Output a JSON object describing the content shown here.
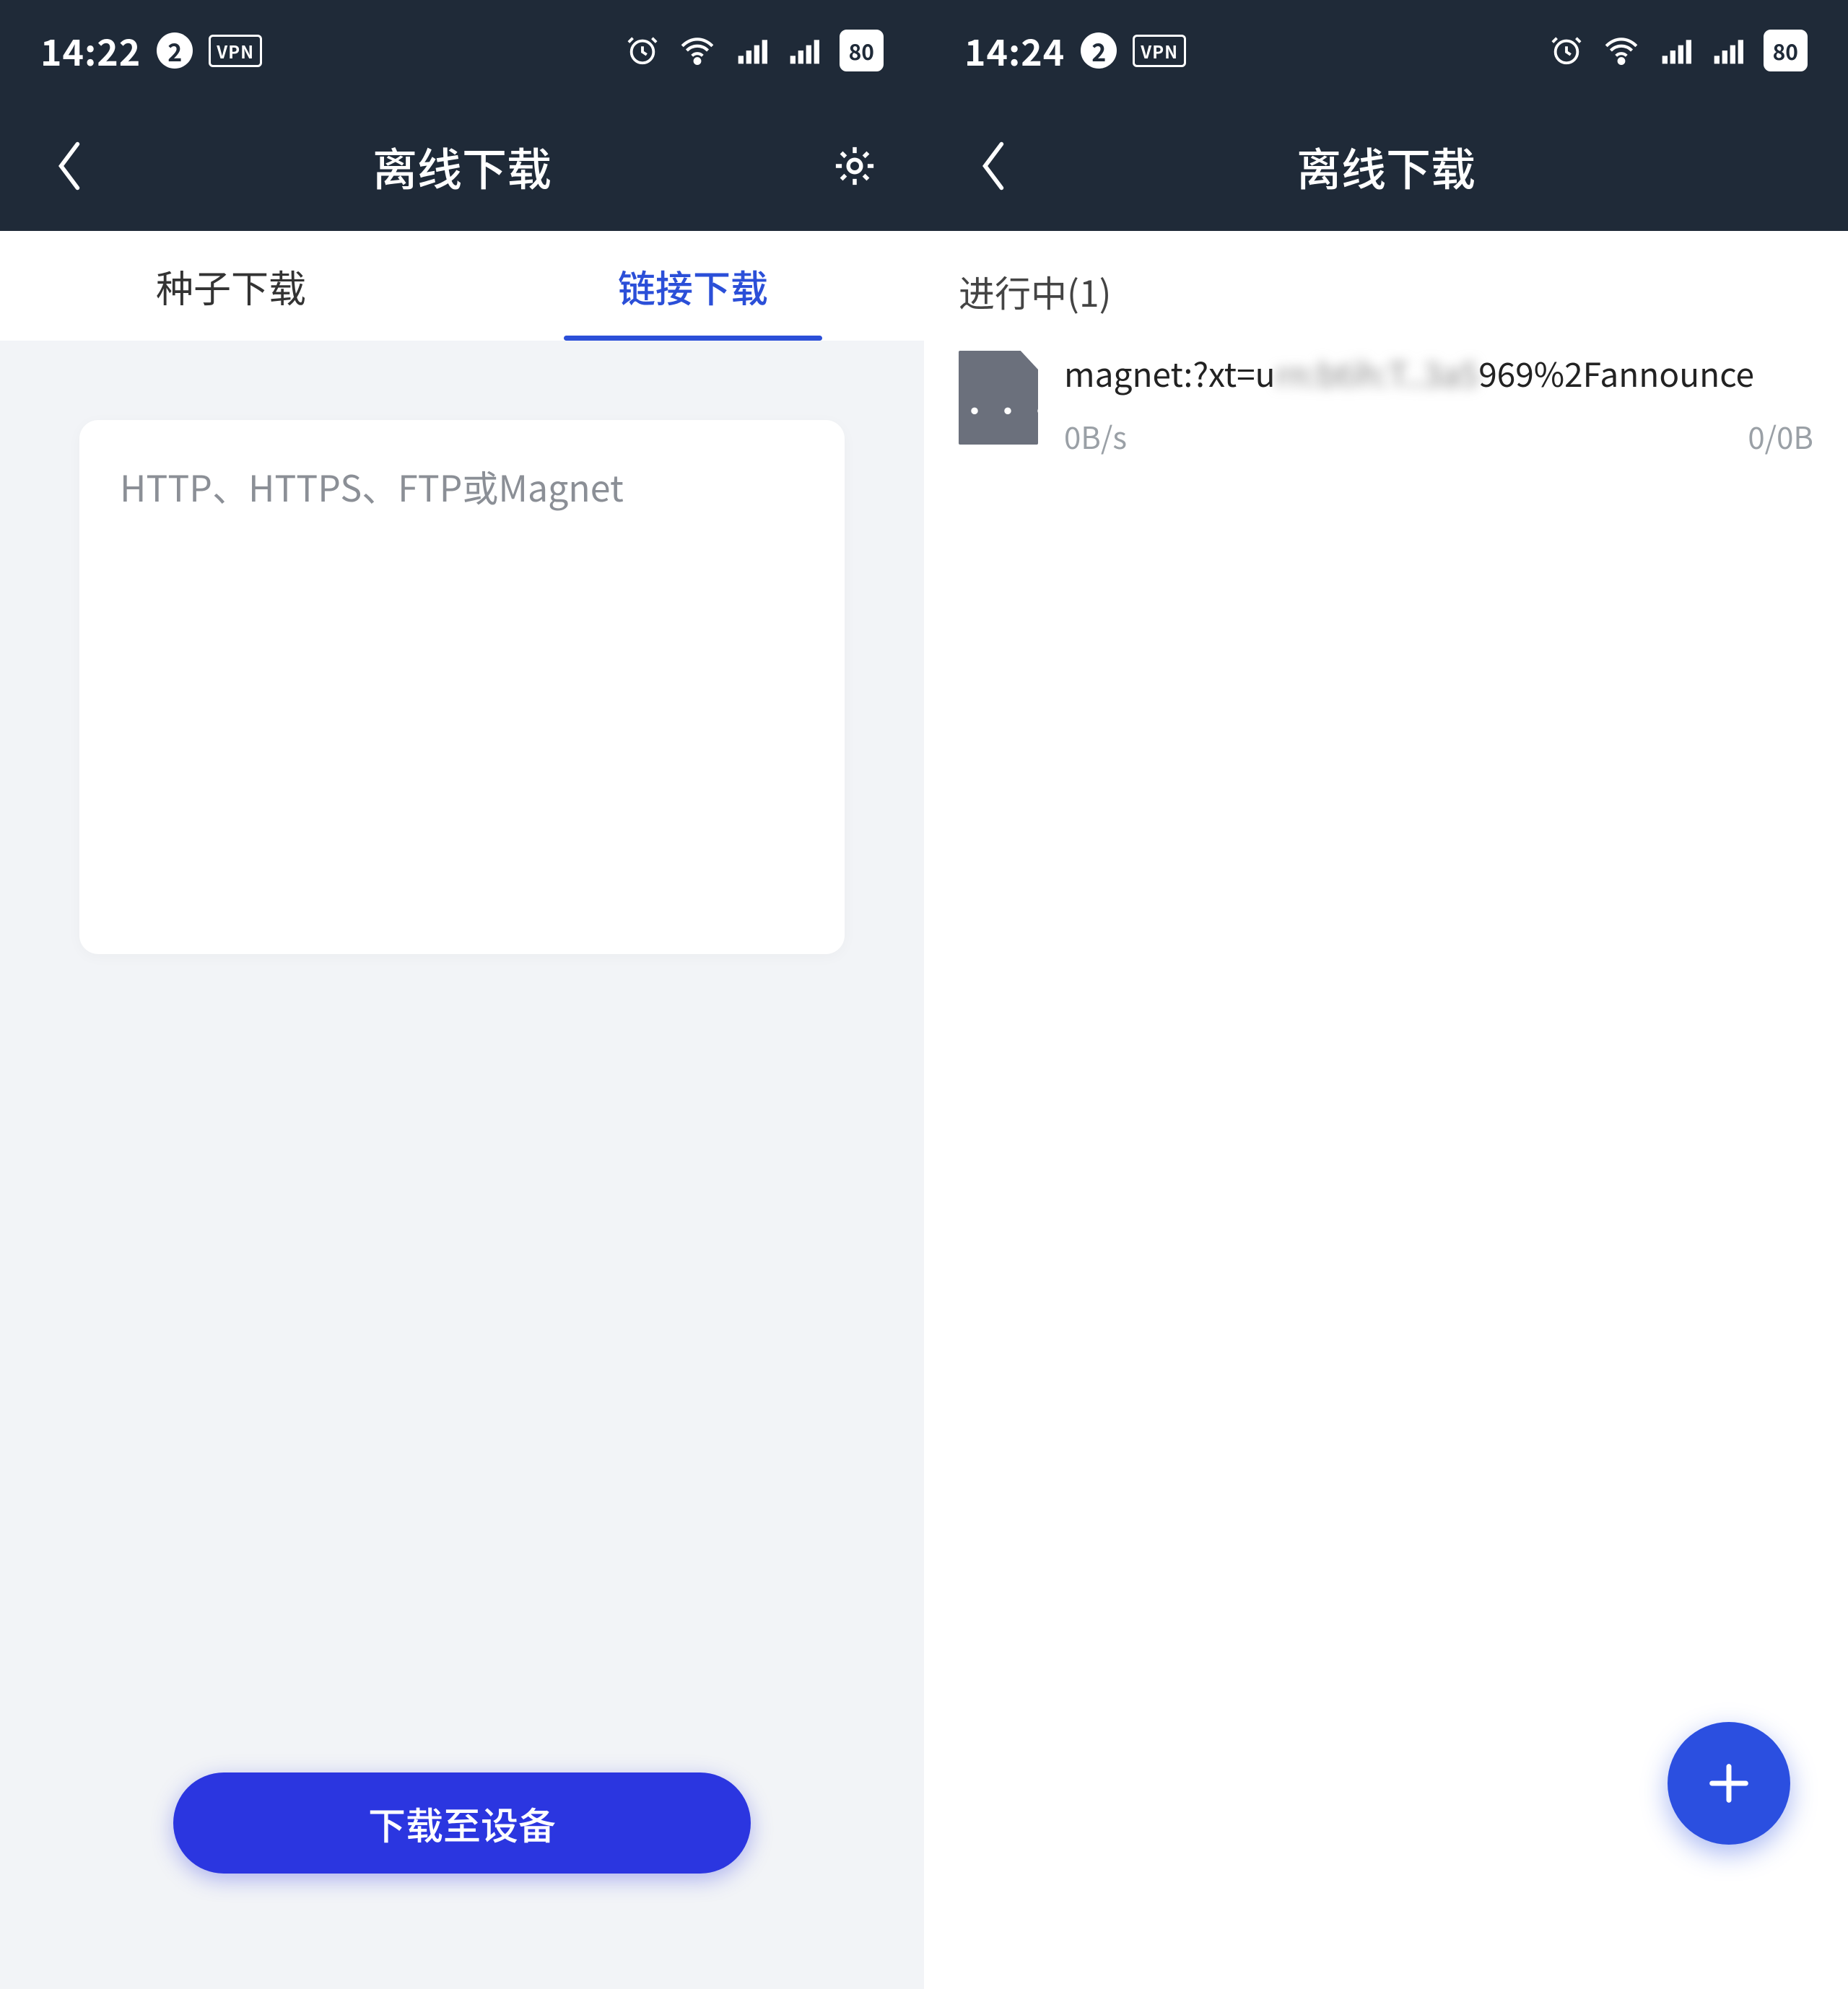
{
  "left": {
    "status": {
      "time": "14:22",
      "notif_count": "2",
      "battery": "80"
    },
    "nav": {
      "title": "离线下载"
    },
    "tabs": [
      {
        "label": "种子下载",
        "active": false
      },
      {
        "label": "链接下载",
        "active": true
      }
    ],
    "input": {
      "placeholder": "HTTP、HTTPS、FTP或Magnet"
    },
    "download_button": "下载至设备"
  },
  "right": {
    "status": {
      "time": "14:24",
      "notif_count": "2",
      "battery": "80"
    },
    "nav": {
      "title": "离线下载"
    },
    "section_label": "进行中(1)",
    "task": {
      "title_prefix": "magnet:?xt=u",
      "title_blur": "rn:btih:T..3a5",
      "title_suffix": "969%2Fannounce",
      "speed": "0B/s",
      "progress": "0/0B"
    }
  }
}
